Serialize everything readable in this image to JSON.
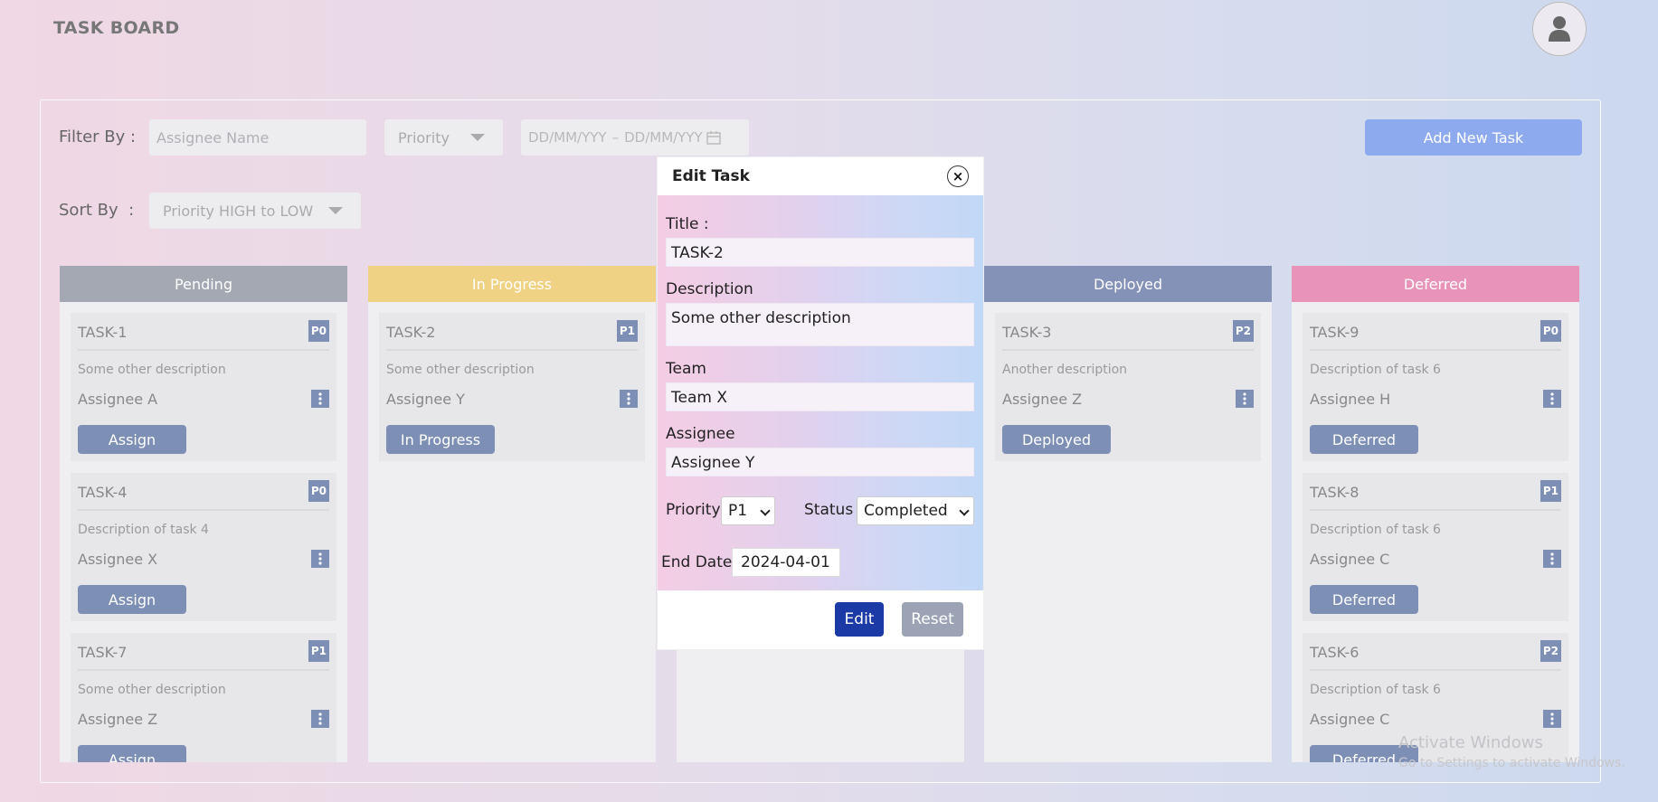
{
  "app": {
    "title": "TASK BOARD",
    "avatar_icon": "user-icon"
  },
  "filters": {
    "filter_label": "Filter By :",
    "assignee_placeholder": "Assignee Name",
    "priority_placeholder": "Priority",
    "date_start_placeholder": "DD/MM/YYY",
    "date_separator": "–",
    "date_end_placeholder": "DD/MM/YYY",
    "sort_label": "Sort By  :",
    "sort_value": "Priority HIGH to LOW",
    "add_button": "Add New Task"
  },
  "columns": {
    "pending": {
      "title": "Pending",
      "color": "#a4a8b3"
    },
    "in_progress": {
      "title": "In Progress",
      "color": "#efd283"
    },
    "completed": {
      "title": "",
      "color": "#96a6c8"
    },
    "deployed": {
      "title": "Deployed",
      "color": "#8592b8"
    },
    "deferred": {
      "title": "Deferred",
      "color": "#e894b9"
    }
  },
  "cards": {
    "pending": [
      {
        "title": "TASK-1",
        "priority": "P0",
        "description": "Some other description",
        "assignee": "Assignee A",
        "action": "Assign"
      },
      {
        "title": "TASK-4",
        "priority": "P0",
        "description": "Description of task 4",
        "assignee": "Assignee X",
        "action": "Assign"
      },
      {
        "title": "TASK-7",
        "priority": "P1",
        "description": "Some other description",
        "assignee": "Assignee Z",
        "action": "Assign"
      }
    ],
    "in_progress": [
      {
        "title": "TASK-2",
        "priority": "P1",
        "description": "Some other description",
        "assignee": "Assignee Y",
        "action": "In Progress"
      }
    ],
    "deployed": [
      {
        "title": "TASK-3",
        "priority": "P2",
        "description": "Another description",
        "assignee": "Assignee Z",
        "action": "Deployed"
      }
    ],
    "deferred": [
      {
        "title": "TASK-9",
        "priority": "P0",
        "description": "Description of task 6",
        "assignee": "Assignee H",
        "action": "Deferred"
      },
      {
        "title": "TASK-8",
        "priority": "P1",
        "description": "Description of task 6",
        "assignee": "Assignee C",
        "action": "Deferred"
      },
      {
        "title": "TASK-6",
        "priority": "P2",
        "description": "Description of task 6",
        "assignee": "Assignee C",
        "action": "Deferred"
      }
    ]
  },
  "modal": {
    "title": "Edit Task",
    "close_icon": "×",
    "title_label": "Title :",
    "title_value": "TASK-2",
    "description_label": "Description",
    "description_value": "Some other description",
    "team_label": "Team",
    "team_value": "Team X",
    "assignee_label": "Assignee",
    "assignee_value": "Assignee Y",
    "priority_label": "Priority",
    "priority_value": "P1",
    "status_label": "Status",
    "status_value": "Completed",
    "end_date_label": "End Date",
    "end_date_value": "2024-04-01",
    "edit_button": "Edit",
    "reset_button": "Reset"
  },
  "watermark": {
    "title": "Activate Windows",
    "subtitle": "Go to Settings to activate Windows."
  }
}
